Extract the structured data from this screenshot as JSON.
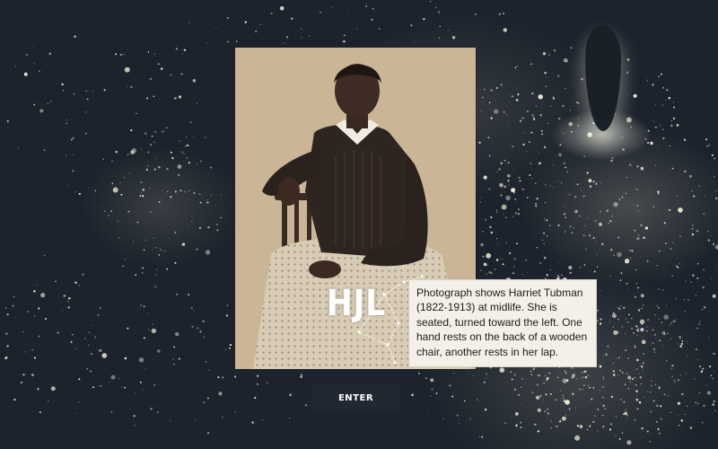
{
  "background": {
    "description_icon": "night-lights-map-icon",
    "dot_color": "#f4f1dc"
  },
  "portrait": {
    "photo_icon": "portrait-photo-icon"
  },
  "logo": {
    "text": "HJL"
  },
  "caption": {
    "text": "Photograph shows Harriet Tubman (1822-1913) at midlife. She is seated, turned toward the left. One hand rests on the back of a wooden chair, another rests in her lap."
  },
  "enter": {
    "label": "ENTER"
  },
  "colors": {
    "background": "#1d232c",
    "button_bg": "#222831",
    "caption_bg": "#f3f0e8",
    "sepia": "#c9b596"
  }
}
